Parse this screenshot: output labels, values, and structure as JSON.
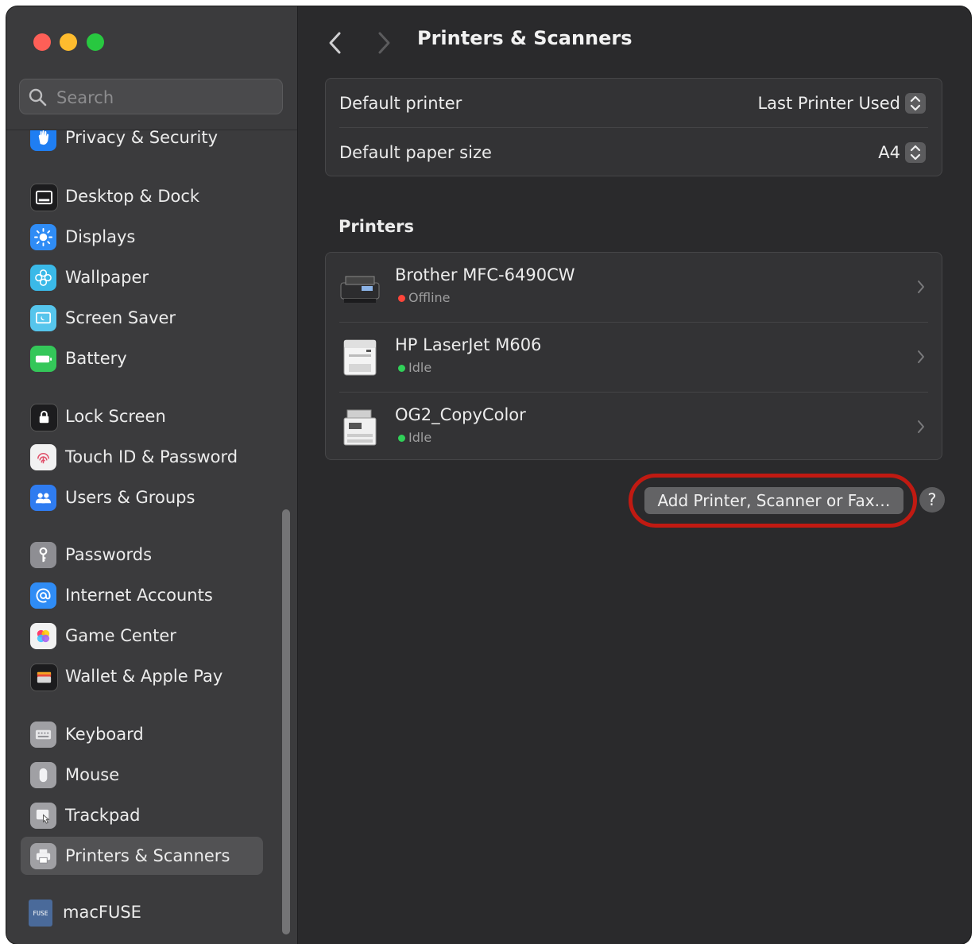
{
  "window": {
    "title": "Printers & Scanners"
  },
  "search": {
    "placeholder": "Search"
  },
  "sidebar": {
    "items": [
      {
        "label": "Privacy & Security",
        "icon": "hand-icon",
        "color": "#1f7ef2"
      },
      {
        "label": "Desktop & Dock",
        "icon": "dock-icon",
        "color": "#1c1c1e"
      },
      {
        "label": "Displays",
        "icon": "sun-icon",
        "color": "#2f8cf5"
      },
      {
        "label": "Wallpaper",
        "icon": "flower-icon",
        "color": "#3ab9e8"
      },
      {
        "label": "Screen Saver",
        "icon": "screen-saver-icon",
        "color": "#56c5ec"
      },
      {
        "label": "Battery",
        "icon": "battery-icon",
        "color": "#34c759"
      },
      {
        "label": "Lock Screen",
        "icon": "lock-icon",
        "color": "#1c1c1e"
      },
      {
        "label": "Touch ID & Password",
        "icon": "fingerprint-icon",
        "color": "#f2f2f2"
      },
      {
        "label": "Users & Groups",
        "icon": "users-icon",
        "color": "#2f7cf0"
      },
      {
        "label": "Passwords",
        "icon": "key-icon",
        "color": "#8e8e93"
      },
      {
        "label": "Internet Accounts",
        "icon": "at-icon",
        "color": "#2f8cf5"
      },
      {
        "label": "Game Center",
        "icon": "game-center-icon",
        "color": "#f2f2f2"
      },
      {
        "label": "Wallet & Apple Pay",
        "icon": "wallet-icon",
        "color": "#1c1c1e"
      },
      {
        "label": "Keyboard",
        "icon": "keyboard-icon",
        "color": "#a0a0a4"
      },
      {
        "label": "Mouse",
        "icon": "mouse-icon",
        "color": "#a0a0a4"
      },
      {
        "label": "Trackpad",
        "icon": "trackpad-icon",
        "color": "#a0a0a4"
      },
      {
        "label": "Printers & Scanners",
        "icon": "printer-icon",
        "color": "#a0a0a4",
        "selected": true
      },
      {
        "label": "macFUSE",
        "icon": "macfuse-icon",
        "color": "#4a6a9a",
        "icon_text": "FUSE"
      }
    ]
  },
  "defaults": {
    "printer_label": "Default printer",
    "printer_value": "Last Printer Used",
    "paper_label": "Default paper size",
    "paper_value": "A4"
  },
  "printers": {
    "section_title": "Printers",
    "items": [
      {
        "name": "Brother MFC-6490CW",
        "status": "Offline",
        "status_color": "#ff453a"
      },
      {
        "name": "HP LaserJet M606",
        "status": "Idle",
        "status_color": "#30d158"
      },
      {
        "name": "OG2_CopyColor",
        "status": "Idle",
        "status_color": "#30d158"
      }
    ]
  },
  "actions": {
    "add_label": "Add Printer, Scanner or Fax…",
    "help_label": "?"
  },
  "colors": {
    "highlight": "#c01a12"
  }
}
